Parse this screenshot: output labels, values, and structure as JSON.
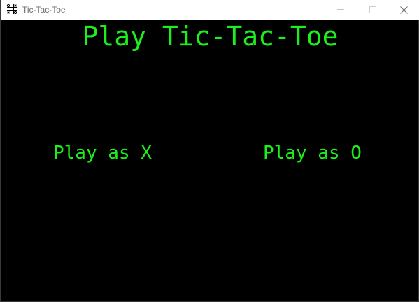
{
  "window": {
    "title": "Tic-Tac-Toe",
    "icon": "tic-tac-toe-icon"
  },
  "controls": {
    "minimize_icon": "minimize-icon",
    "maximize_icon": "maximize-icon",
    "close_icon": "close-icon"
  },
  "main": {
    "heading": "Play Tic-Tac-Toe",
    "play_x_label": "Play as X",
    "play_o_label": "Play as O"
  },
  "colors": {
    "background": "#000000",
    "accent_green": "#1cf01c",
    "titlebar": "#ffffff"
  }
}
